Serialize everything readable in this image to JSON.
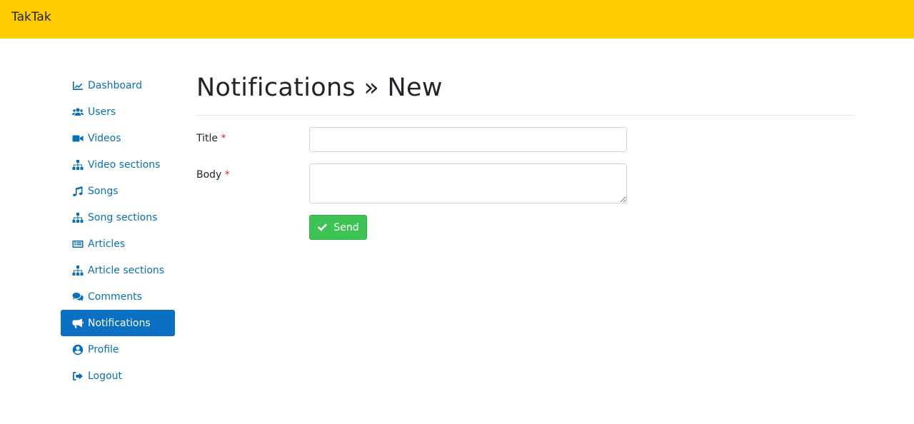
{
  "app": {
    "brand": "TakTak"
  },
  "colors": {
    "topbar": "#ffcc00",
    "link": "#0b6fb6",
    "active": "#0b6fc2",
    "success": "#3ec454",
    "required": "#d9262e"
  },
  "sidebar": {
    "items": [
      {
        "label": "Dashboard",
        "icon": "chart-line-icon"
      },
      {
        "label": "Users",
        "icon": "users-icon"
      },
      {
        "label": "Videos",
        "icon": "video-icon"
      },
      {
        "label": "Video sections",
        "icon": "sitemap-icon"
      },
      {
        "label": "Songs",
        "icon": "music-icon"
      },
      {
        "label": "Song sections",
        "icon": "sitemap-icon"
      },
      {
        "label": "Articles",
        "icon": "newspaper-icon"
      },
      {
        "label": "Article sections",
        "icon": "sitemap-icon"
      },
      {
        "label": "Comments",
        "icon": "comments-icon"
      },
      {
        "label": "Notifications",
        "icon": "bullhorn-icon",
        "active": true
      },
      {
        "label": "Profile",
        "icon": "user-circle-icon"
      },
      {
        "label": "Logout",
        "icon": "sign-out-icon"
      }
    ]
  },
  "main": {
    "title": "Notifications » New",
    "form": {
      "title_label": "Title",
      "body_label": "Body",
      "required_mark": "*",
      "title_value": "",
      "body_value": "",
      "submit_label": "Send",
      "submit_icon": "check-icon"
    }
  }
}
